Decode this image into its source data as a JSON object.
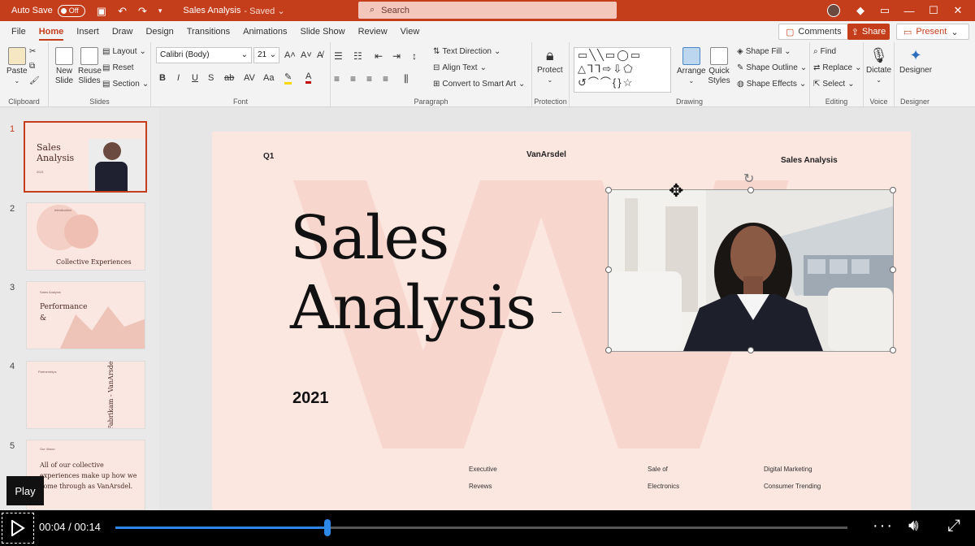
{
  "titlebar": {
    "autosave_label": "Auto Save",
    "autosave_state": "Off",
    "doc_title": "Sales Analysis",
    "saved_status": "Saved",
    "search_placeholder": "Search"
  },
  "tabs": [
    "File",
    "Home",
    "Insert",
    "Draw",
    "Design",
    "Transitions",
    "Animations",
    "Slide Show",
    "Review",
    "View"
  ],
  "active_tab": "Home",
  "actions": {
    "comments": "Comments",
    "share": "Share",
    "present": "Present"
  },
  "ribbon": {
    "clipboard": {
      "paste": "Paste",
      "label": "Clipboard"
    },
    "slides": {
      "new_slide": "New Slide",
      "reuse_slides": "Reuse Slides",
      "layout": "Layout",
      "reset": "Reset",
      "section": "Section",
      "label": "Slides"
    },
    "font": {
      "family": "Calibri (Body)",
      "size": "21",
      "label": "Font"
    },
    "paragraph": {
      "text_direction": "Text Direction",
      "align_text": "Align Text",
      "convert_smartart": "Convert to Smart Art",
      "label": "Paragraph"
    },
    "protection": {
      "protect": "Protect",
      "label": "Protection"
    },
    "drawing": {
      "arrange": "Arrange",
      "quick_styles": "Quick Styles",
      "shape_fill": "Shape Fill",
      "shape_outline": "Shape Outline",
      "shape_effects": "Shape Effects",
      "label": "Drawing"
    },
    "editing": {
      "find": "Find",
      "replace": "Replace",
      "select": "Select",
      "label": "Editing"
    },
    "voice": {
      "dictate": "Dictate",
      "label": "Voice"
    },
    "designer": {
      "designer": "Designer",
      "label": "Designer"
    }
  },
  "thumbnails": [
    {
      "num": "1",
      "title": "Sales Analysis",
      "sub": "2021"
    },
    {
      "num": "2",
      "title": "Collective Experiences",
      "sub": "Introduction"
    },
    {
      "num": "3",
      "title": "Performance &",
      "sub": "Sales Analysis"
    },
    {
      "num": "4",
      "title": "Fabrikam - VanArsdel",
      "sub": "Partnerships"
    },
    {
      "num": "5",
      "title": "All of our collective experiences make up how we come through as VanArsdel.",
      "sub": "Our Vision"
    }
  ],
  "slide": {
    "q1": "Q1",
    "brand": "VanArsdel",
    "header_right": "Sales Analysis",
    "title_line1": "Sales",
    "title_line2": "Analysis",
    "year": "2021",
    "footer": [
      {
        "line1": "Executive",
        "line2": "Revews"
      },
      {
        "line1": "Sale of",
        "line2": "Electronics"
      },
      {
        "line1": "Digital Marketing",
        "line2": "Consumer Trending"
      }
    ]
  },
  "player": {
    "time": "00:04 / 00:14",
    "progress": 0.29,
    "tooltip": "Play"
  },
  "colors": {
    "accent": "#c43e1c",
    "slide_bg": "#fbe6e0",
    "progress": "#2e88e8"
  }
}
